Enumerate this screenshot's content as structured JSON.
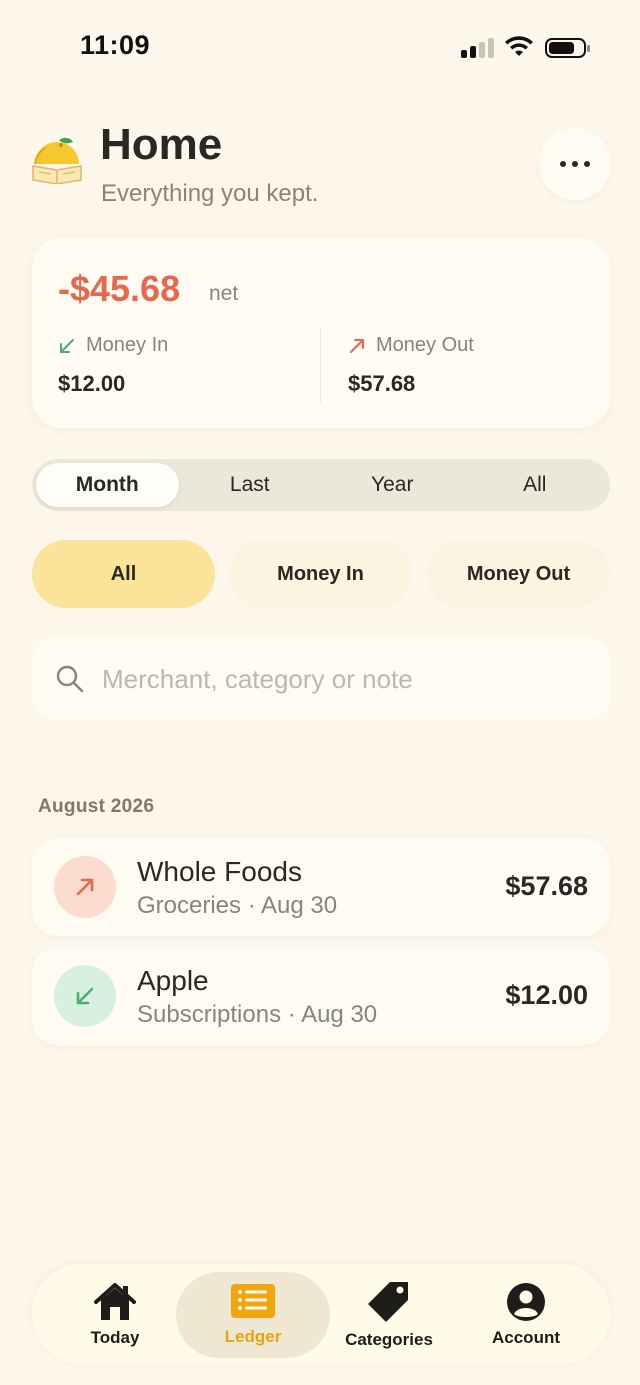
{
  "status_bar": {
    "time": "11:09"
  },
  "header": {
    "title": "Home",
    "subtitle": "Everything you kept."
  },
  "summary": {
    "net_amount": "-$45.68",
    "net_label": "net",
    "money_in_label": "Money In",
    "money_in_amount": "$12.00",
    "money_out_label": "Money Out",
    "money_out_amount": "$57.68"
  },
  "period_tabs": [
    "Month",
    "Last",
    "Year",
    "All"
  ],
  "period_selected": "Month",
  "filters": [
    "All",
    "Money In",
    "Money Out"
  ],
  "filter_selected": "All",
  "search": {
    "placeholder": "Merchant, category or note",
    "value": ""
  },
  "section": {
    "title": "August 2026"
  },
  "transactions": [
    {
      "merchant": "Whole Foods",
      "meta": "Groceries · Aug 30",
      "amount": "$57.68",
      "direction": "out"
    },
    {
      "merchant": "Apple",
      "meta": "Subscriptions · Aug 30",
      "amount": "$12.00",
      "direction": "in"
    }
  ],
  "nav": {
    "items": [
      {
        "label": "Today",
        "icon": "house-icon"
      },
      {
        "label": "Ledger",
        "icon": "ledger-icon"
      },
      {
        "label": "Categories",
        "icon": "tag-icon"
      },
      {
        "label": "Account",
        "icon": "person-icon"
      }
    ],
    "selected": "Ledger"
  },
  "colors": {
    "background": "#fdf6ea",
    "negative": "#e8684f",
    "positive": "#4caf72",
    "accent": "#e8a410",
    "chip_active": "#fbe49a"
  }
}
